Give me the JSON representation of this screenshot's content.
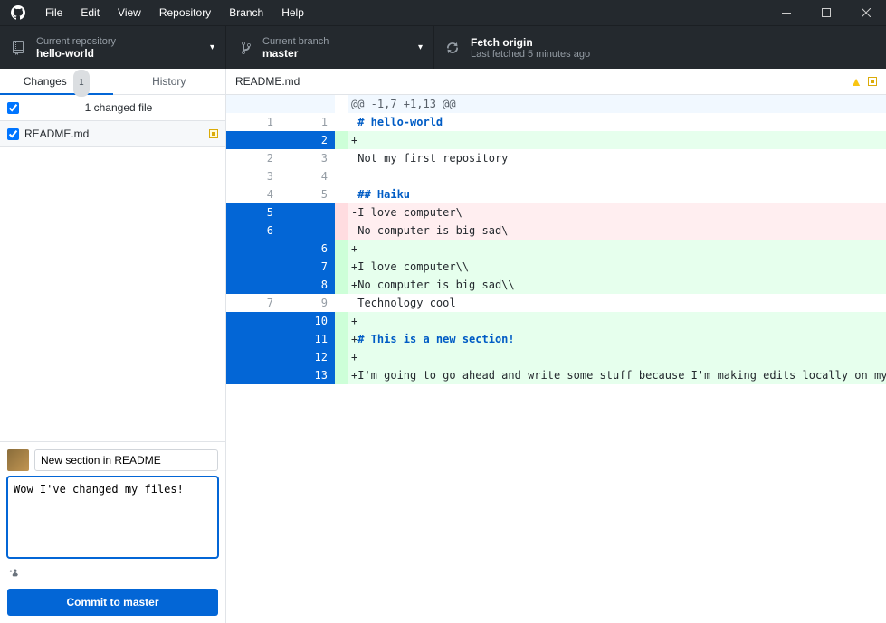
{
  "menu": {
    "items": [
      "File",
      "Edit",
      "View",
      "Repository",
      "Branch",
      "Help"
    ]
  },
  "toolbar": {
    "repo": {
      "label": "Current repository",
      "value": "hello-world"
    },
    "branch": {
      "label": "Current branch",
      "value": "master"
    },
    "fetch": {
      "label": "Fetch origin",
      "value": "Last fetched 5 minutes ago"
    }
  },
  "tabs": {
    "changes": {
      "label": "Changes",
      "count": "1"
    },
    "history": {
      "label": "History"
    }
  },
  "changed": {
    "label": "1 changed file"
  },
  "file": {
    "name": "README.md"
  },
  "commit": {
    "summary": "New section in README",
    "description": "Wow I've changed my files!",
    "button_prefix": "Commit to ",
    "button_branch": "master"
  },
  "diff": {
    "filename": "README.md",
    "rows": [
      {
        "type": "hunk",
        "old": "",
        "new": "",
        "old_sel": false,
        "new_sel": false,
        "text": "@@ -1,7 +1,13 @@"
      },
      {
        "type": "ctx",
        "old": "1",
        "new": "1",
        "old_sel": false,
        "new_sel": false,
        "text": " # hello-world",
        "md": "h1"
      },
      {
        "type": "add",
        "old": "",
        "new": "2",
        "old_sel": true,
        "new_sel": true,
        "text": "+"
      },
      {
        "type": "ctx",
        "old": "2",
        "new": "3",
        "old_sel": false,
        "new_sel": false,
        "text": " Not my first repository"
      },
      {
        "type": "ctx",
        "old": "3",
        "new": "4",
        "old_sel": false,
        "new_sel": false,
        "text": " "
      },
      {
        "type": "ctx",
        "old": "4",
        "new": "5",
        "old_sel": false,
        "new_sel": false,
        "text": " ## Haiku",
        "md": "h2"
      },
      {
        "type": "del",
        "old": "5",
        "new": "",
        "old_sel": true,
        "new_sel": true,
        "text": "-I love computer\\"
      },
      {
        "type": "del",
        "old": "6",
        "new": "",
        "old_sel": true,
        "new_sel": true,
        "text": "-No computer is big sad\\"
      },
      {
        "type": "add",
        "old": "",
        "new": "6",
        "old_sel": true,
        "new_sel": true,
        "text": "+"
      },
      {
        "type": "add",
        "old": "",
        "new": "7",
        "old_sel": true,
        "new_sel": true,
        "text": "+I love computer\\\\"
      },
      {
        "type": "add",
        "old": "",
        "new": "8",
        "old_sel": true,
        "new_sel": true,
        "text": "+No computer is big sad\\\\"
      },
      {
        "type": "ctx",
        "old": "7",
        "new": "9",
        "old_sel": false,
        "new_sel": false,
        "text": " Technology cool"
      },
      {
        "type": "add",
        "old": "",
        "new": "10",
        "old_sel": true,
        "new_sel": true,
        "text": "+"
      },
      {
        "type": "add",
        "old": "",
        "new": "11",
        "old_sel": true,
        "new_sel": true,
        "text": "+# This is a new section!",
        "md": "h1"
      },
      {
        "type": "add",
        "old": "",
        "new": "12",
        "old_sel": true,
        "new_sel": true,
        "text": "+"
      },
      {
        "type": "add",
        "old": "",
        "new": "13",
        "old_sel": true,
        "new_sel": true,
        "text": "+I'm going to go ahead and write some stuff because I'm making edits locally on my computer!"
      }
    ]
  }
}
